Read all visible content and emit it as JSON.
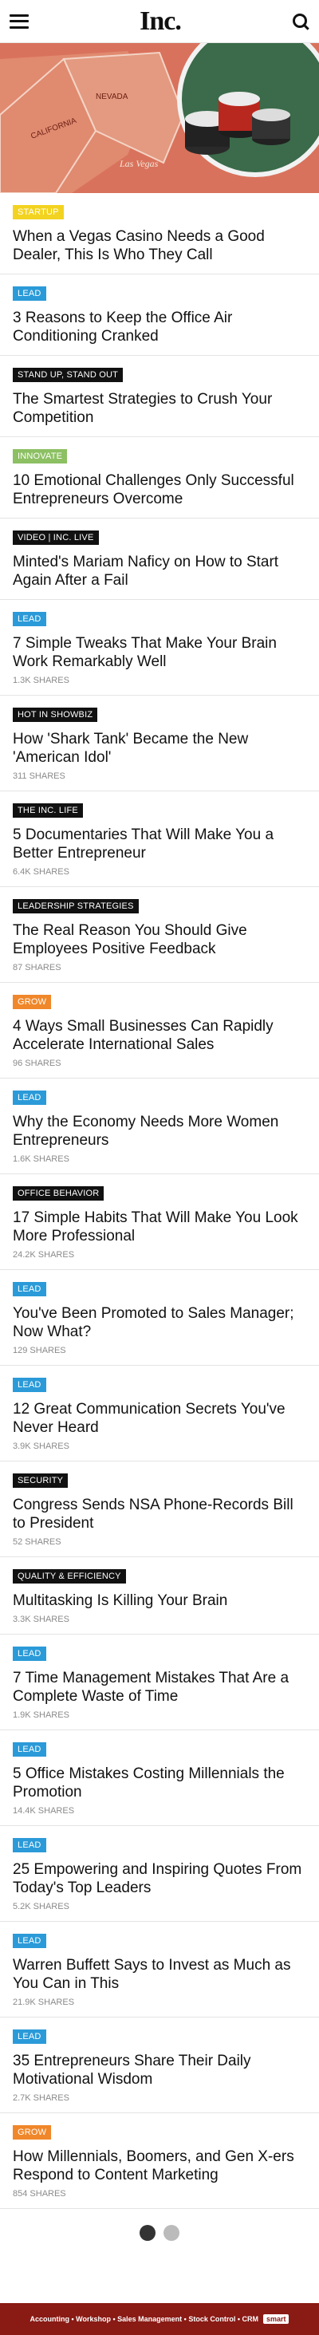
{
  "header": {
    "logo": "Inc.",
    "menu_icon": "hamburger-icon",
    "search_icon": "search-icon"
  },
  "hero": {
    "label_nevada": "NEVADA",
    "label_california": "CALIFORNIA",
    "label_city": "Las Vegas"
  },
  "articles": [
    {
      "tag": "STARTUP",
      "tag_color": "#f3d321",
      "title": "When a Vegas Casino Needs a Good Dealer, This Is Who They Call",
      "shares": ""
    },
    {
      "tag": "LEAD",
      "tag_color": "#2b9ad8",
      "title": "3 Reasons to Keep the Office Air Conditioning Cranked",
      "shares": ""
    },
    {
      "tag": "STAND UP, STAND OUT",
      "tag_color": "#111111",
      "title": "The Smartest Strategies to Crush Your Competition",
      "shares": ""
    },
    {
      "tag": "INNOVATE",
      "tag_color": "#8cc063",
      "title": "10 Emotional Challenges Only Successful Entrepreneurs Overcome",
      "shares": ""
    },
    {
      "tag": "VIDEO | INC. LIVE",
      "tag_color": "#111111",
      "title": "Minted's Mariam Naficy on How to Start Again After a Fail",
      "shares": ""
    },
    {
      "tag": "LEAD",
      "tag_color": "#2b9ad8",
      "title": "7 Simple Tweaks That Make Your Brain Work Remarkably Well",
      "shares": "1.3k SHARES"
    },
    {
      "tag": "HOT IN SHOWBIZ",
      "tag_color": "#111111",
      "title": "How 'Shark Tank' Became the New 'American Idol'",
      "shares": "311 SHARES"
    },
    {
      "tag": "THE INC. LIFE",
      "tag_color": "#111111",
      "title": "5 Documentaries That Will Make You a Better Entrepreneur",
      "shares": "6.4k SHARES"
    },
    {
      "tag": "LEADERSHIP STRATEGIES",
      "tag_color": "#111111",
      "title": "The Real Reason You Should Give Employees Positive Feedback",
      "shares": "87 SHARES"
    },
    {
      "tag": "GROW",
      "tag_color": "#f0872a",
      "title": "4 Ways Small Businesses Can Rapidly Accelerate International Sales",
      "shares": "96 SHARES"
    },
    {
      "tag": "LEAD",
      "tag_color": "#2b9ad8",
      "title": "Why the Economy Needs More Women Entrepreneurs",
      "shares": "1.6k SHARES"
    },
    {
      "tag": "OFFICE BEHAVIOR",
      "tag_color": "#111111",
      "title": "17 Simple Habits That Will Make You Look More Professional",
      "shares": "24.2k SHARES"
    },
    {
      "tag": "LEAD",
      "tag_color": "#2b9ad8",
      "title": "You've Been Promoted to Sales Manager; Now What?",
      "shares": "129 SHARES"
    },
    {
      "tag": "LEAD",
      "tag_color": "#2b9ad8",
      "title": "12 Great Communication Secrets You've Never Heard",
      "shares": "3.9k SHARES"
    },
    {
      "tag": "SECURITY",
      "tag_color": "#111111",
      "title": "Congress Sends NSA Phone-Records Bill to President",
      "shares": "52 SHARES"
    },
    {
      "tag": "QUALITY & EFFICIENCY",
      "tag_color": "#111111",
      "title": "Multitasking Is Killing Your Brain",
      "shares": "3.3k SHARES"
    },
    {
      "tag": "LEAD",
      "tag_color": "#2b9ad8",
      "title": "7 Time Management Mistakes That Are a Complete Waste of Time",
      "shares": "1.9k SHARES"
    },
    {
      "tag": "LEAD",
      "tag_color": "#2b9ad8",
      "title": "5 Office Mistakes Costing Millennials the Promotion",
      "shares": "14.4k SHARES"
    },
    {
      "tag": "LEAD",
      "tag_color": "#2b9ad8",
      "title": "25 Empowering and Inspiring Quotes From Today's Top Leaders",
      "shares": "5.2k SHARES"
    },
    {
      "tag": "LEAD",
      "tag_color": "#2b9ad8",
      "title": "Warren Buffett Says to Invest as Much as You Can in This",
      "shares": "21.9k SHARES"
    },
    {
      "tag": "LEAD",
      "tag_color": "#2b9ad8",
      "title": "35 Entrepreneurs Share Their Daily Motivational Wisdom",
      "shares": "2.7k SHARES"
    },
    {
      "tag": "GROW",
      "tag_color": "#f0872a",
      "title": "How Millennials, Boomers, and Gen X-ers Respond to Content Marketing",
      "shares": "854 SHARES"
    }
  ],
  "ad": {
    "text": "Accounting • Workshop • Sales Management • Stock Control • CRM",
    "logo": "smart"
  }
}
